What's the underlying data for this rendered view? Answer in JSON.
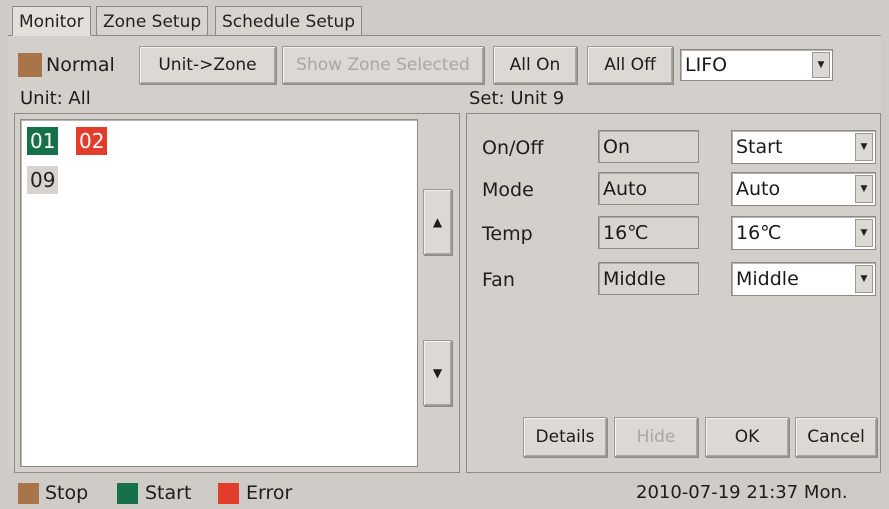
{
  "tabs": [
    {
      "label": "Monitor"
    },
    {
      "label": "Zone Setup"
    },
    {
      "label": "Schedule Setup"
    }
  ],
  "toolbar": {
    "legend_normal_label": "Normal",
    "legend_normal_color": "#a8754b",
    "unit_zone_label": "Unit->Zone",
    "show_zone_selected_label": "Show Zone Selected",
    "all_on_label": "All On",
    "all_off_label": "All Off",
    "order_select_value": "LIFO"
  },
  "unit_panel": {
    "title": "Unit: All",
    "units": [
      {
        "id": "01",
        "color": "#16704a"
      },
      {
        "id": "02",
        "color": "#e23c2a"
      },
      {
        "id": "09",
        "color": "#d7d3cf"
      }
    ]
  },
  "set_panel": {
    "title": "Set: Unit 9",
    "rows": [
      {
        "label": "On/Off",
        "current": "On",
        "select": "Start"
      },
      {
        "label": "Mode",
        "current": "Auto",
        "select": "Auto"
      },
      {
        "label": "Temp",
        "current": "16℃",
        "select": "16℃"
      },
      {
        "label": "Fan",
        "current": "Middle",
        "select": "Middle"
      }
    ],
    "buttons": {
      "details": "Details",
      "hide": "Hide",
      "ok": "OK",
      "cancel": "Cancel"
    }
  },
  "status_bar": {
    "legend": [
      {
        "label": "Stop",
        "color": "#a8754b"
      },
      {
        "label": "Start",
        "color": "#16704a"
      },
      {
        "label": "Error",
        "color": "#e23c2a"
      }
    ],
    "datetime": "2010-07-19 21:37 Mon."
  }
}
